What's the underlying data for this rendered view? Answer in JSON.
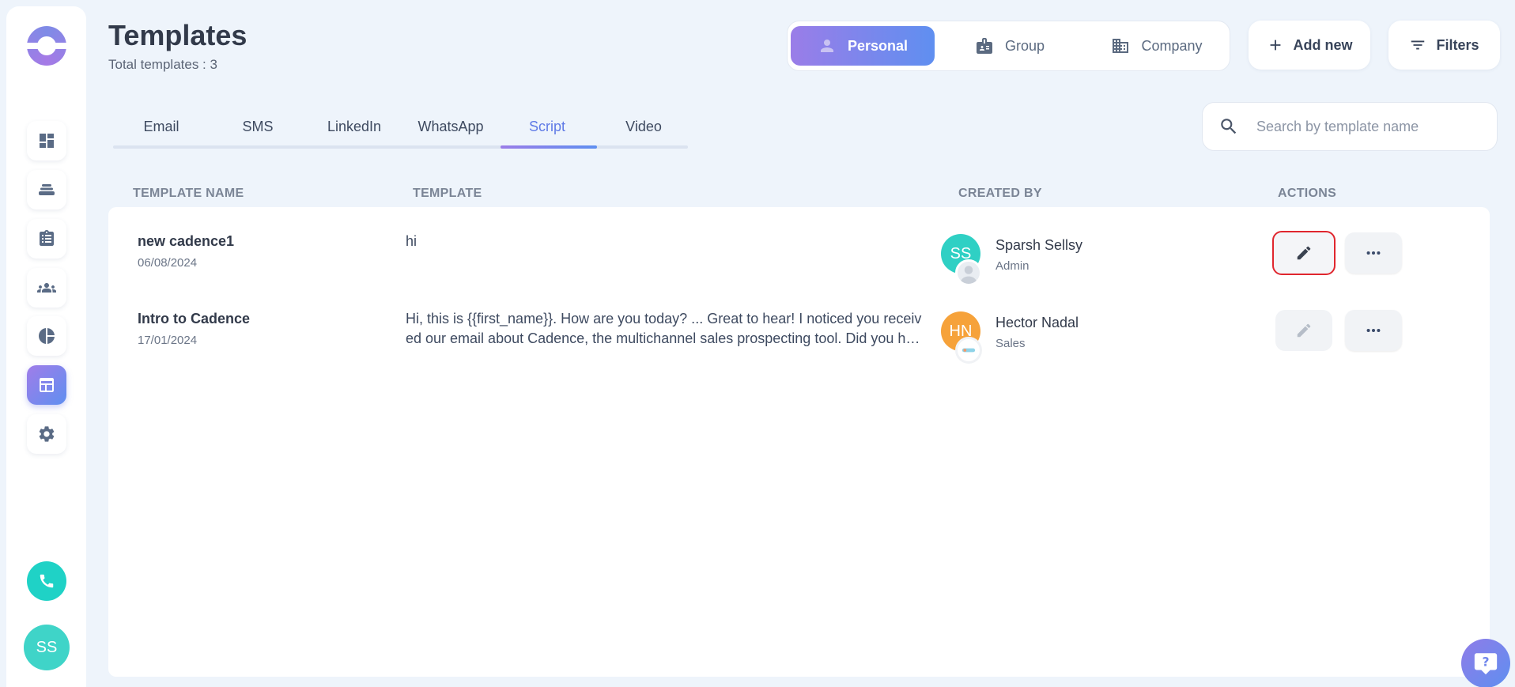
{
  "header": {
    "title": "Templates",
    "subtitle": "Total templates : 3"
  },
  "scope": {
    "items": [
      {
        "label": "Personal",
        "icon": "person-icon",
        "active": true
      },
      {
        "label": "Group",
        "icon": "id-card-icon",
        "active": false
      },
      {
        "label": "Company",
        "icon": "building-icon",
        "active": false
      }
    ]
  },
  "actions": {
    "add_new": "Add new",
    "filters": "Filters"
  },
  "tabs": [
    {
      "label": "Email"
    },
    {
      "label": "SMS"
    },
    {
      "label": "LinkedIn"
    },
    {
      "label": "WhatsApp"
    },
    {
      "label": "Script",
      "active": true
    },
    {
      "label": "Video"
    }
  ],
  "search": {
    "placeholder": "Search by template name",
    "value": ""
  },
  "table": {
    "columns": [
      "TEMPLATE NAME",
      "TEMPLATE",
      "CREATED BY",
      "ACTIONS"
    ],
    "rows": [
      {
        "name": "new cadence1",
        "date": "06/08/2024",
        "template": "hi",
        "creator_initials": "SS",
        "creator_name": "Sparsh Sellsy",
        "creator_role": "Admin",
        "avatar_color": "#2fd0c4",
        "edit_highlighted": true
      },
      {
        "name": "Intro to Cadence",
        "date": "17/01/2024",
        "template": "Hi, this is {{first_name}}. How are you today? ... Great to hear! I noticed you received our email about Cadence, the multichannel sales prospecting tool. Did you have a chance to look at it?",
        "creator_initials": "HN",
        "creator_name": "Hector Nadal",
        "creator_role": "Sales",
        "avatar_color": "#f6a23a",
        "edit_highlighted": false
      }
    ]
  },
  "sidebar": {
    "items": [
      {
        "icon": "dashboard-icon"
      },
      {
        "icon": "cadence-stack-icon"
      },
      {
        "icon": "tasks-clipboard-icon"
      },
      {
        "icon": "people-icon"
      },
      {
        "icon": "pie-chart-icon"
      },
      {
        "icon": "templates-icon",
        "active": true
      },
      {
        "icon": "gear-icon"
      }
    ],
    "user_initials": "SS"
  },
  "colors": {
    "accent_start": "#9a7de8",
    "accent_end": "#5f8ff0",
    "teal": "#1fd2c6",
    "highlight_red": "#e0262e"
  }
}
